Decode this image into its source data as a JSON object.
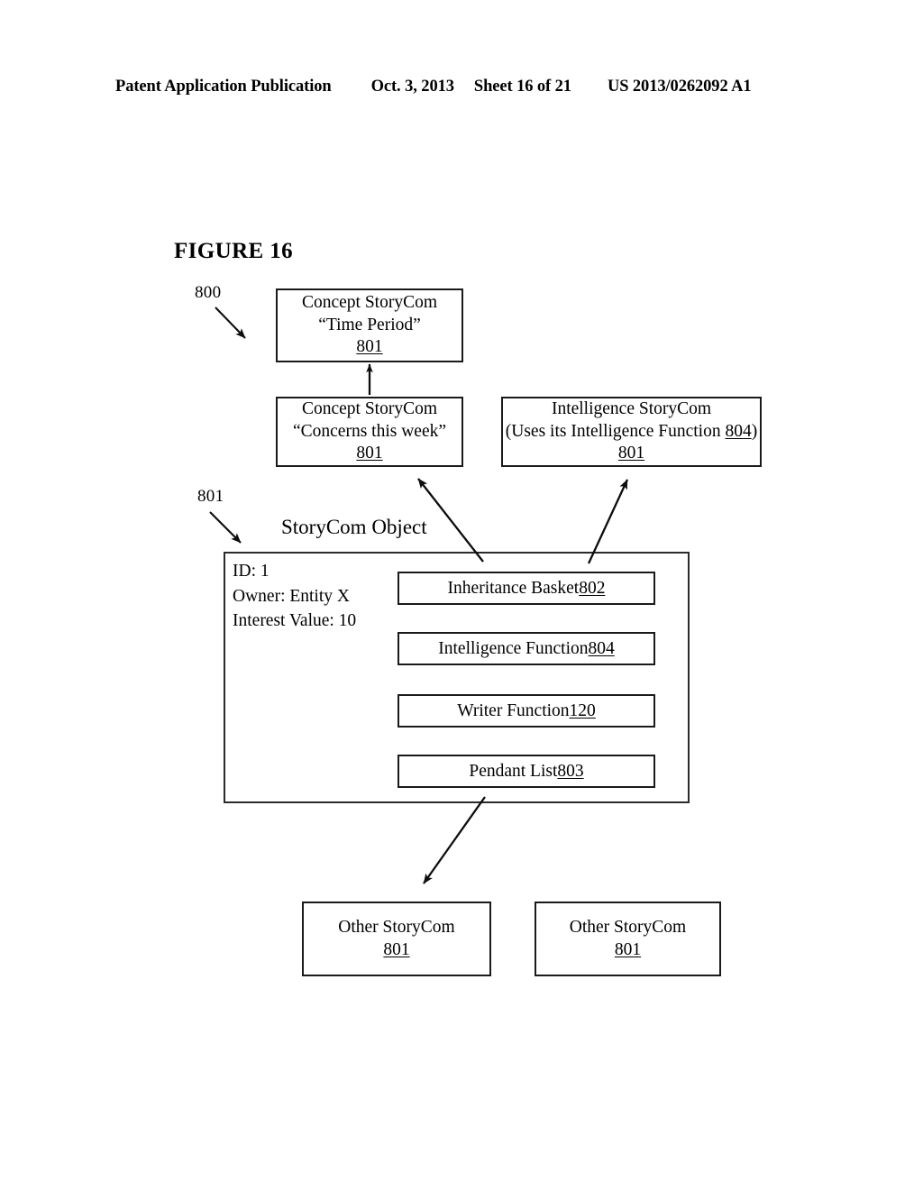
{
  "header": {
    "publication": "Patent Application Publication",
    "date": "Oct. 3, 2013",
    "sheet": "Sheet 16 of 21",
    "patent_number": "US 2013/0262092 A1"
  },
  "figure": {
    "title": "FIGURE 16",
    "callouts": [
      {
        "label": "800"
      },
      {
        "label": "801"
      }
    ]
  },
  "boxes": {
    "time_period": {
      "line1": "Concept StoryCom",
      "line2": "“Time Period”",
      "ref": "801"
    },
    "concerns_this_week": {
      "line1": "Concept StoryCom",
      "line2": "“Concerns this week”",
      "ref": "801"
    },
    "intelligence_storycom": {
      "line1": "Intelligence StoryCom",
      "line2_prefix": "(Uses its Intelligence Function ",
      "line2_ref": "804",
      "line2_suffix": ")",
      "ref": "801"
    },
    "other_storycom_left": {
      "line1": "Other StoryCom",
      "ref": "801"
    },
    "other_storycom_right": {
      "line1": "Other StoryCom",
      "ref": "801"
    }
  },
  "storycom_object": {
    "title": "StoryCom Object",
    "fields": [
      "ID: 1",
      "Owner: Entity X",
      "Interest Value: 10"
    ],
    "components": [
      {
        "label": "Inheritance Basket ",
        "ref": "802"
      },
      {
        "label": "Intelligence Function ",
        "ref": "804"
      },
      {
        "label": "Writer Function ",
        "ref": "120"
      },
      {
        "label": "Pendant List ",
        "ref": "803"
      }
    ]
  },
  "colors": {
    "ink": "#000000",
    "stroke": "#1a1a1a",
    "paper": "#ffffff"
  }
}
